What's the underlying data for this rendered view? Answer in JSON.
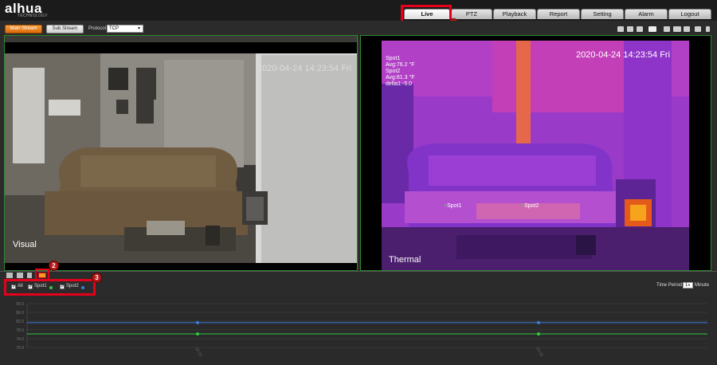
{
  "brand": {
    "logo": "alhua",
    "tagline": "TECHNOLOGY"
  },
  "nav": {
    "tabs": [
      {
        "label": "Live",
        "active": true
      },
      {
        "label": "PTZ"
      },
      {
        "label": "Playback"
      },
      {
        "label": "Report"
      },
      {
        "label": "Setting"
      },
      {
        "label": "Alarm"
      },
      {
        "label": "Logout"
      }
    ]
  },
  "toolbar": {
    "main_stream": "Main Stream",
    "sub_stream": "Sub Stream",
    "protocol_label": "Protocol",
    "protocol_value": "TCP",
    "icons": [
      "alarm-output-icon",
      "user-icon",
      "digital-zoom-icon",
      "snapshot-icon",
      "triple-snapshot-icon",
      "record-icon",
      "talk-icon",
      "audio-icon",
      "mic-icon"
    ]
  },
  "video_visual": {
    "timestamp": "2020-04-24 14:23:54 Fri",
    "label": "Visual"
  },
  "video_thermal": {
    "timestamp": "2020-04-24 14:23:54 Fri",
    "label": "Thermal",
    "stats": [
      "Spot1",
      "Avg:76.2 °F",
      "Spot2",
      "Avg:81.3 °F",
      "delta1:-5.0"
    ],
    "spot1": "Spot1",
    "spot2": "Spot2"
  },
  "annotations": {
    "badge1": "1",
    "badge2": "2",
    "badge3": "3"
  },
  "legend": {
    "all": "All",
    "spot1": "Spot1",
    "spot2": "Spot2",
    "time_period_label": "Time Period",
    "time_period_value": "1",
    "time_period_unit": "Minute"
  },
  "colors": {
    "accent_red": "#e4001b",
    "spot1_color": "#2ecc40",
    "spot2_color": "#3b7dde",
    "primary_button": "#ef8a1f"
  },
  "chart_data": {
    "type": "line",
    "y_ticks": [
      "90.0",
      "86.0",
      "82.0",
      "78.0",
      "74.0",
      "70.0"
    ],
    "x_ticks": [
      "14:23",
      "14:23"
    ],
    "series": [
      {
        "name": "Spot1",
        "color": "#2ecc40",
        "values": [
          76.2,
          76.2,
          76.2
        ]
      },
      {
        "name": "Spot2",
        "color": "#3b7dde",
        "values": [
          81.3,
          81.3,
          81.3
        ]
      }
    ],
    "ylim": [
      70,
      90
    ]
  }
}
